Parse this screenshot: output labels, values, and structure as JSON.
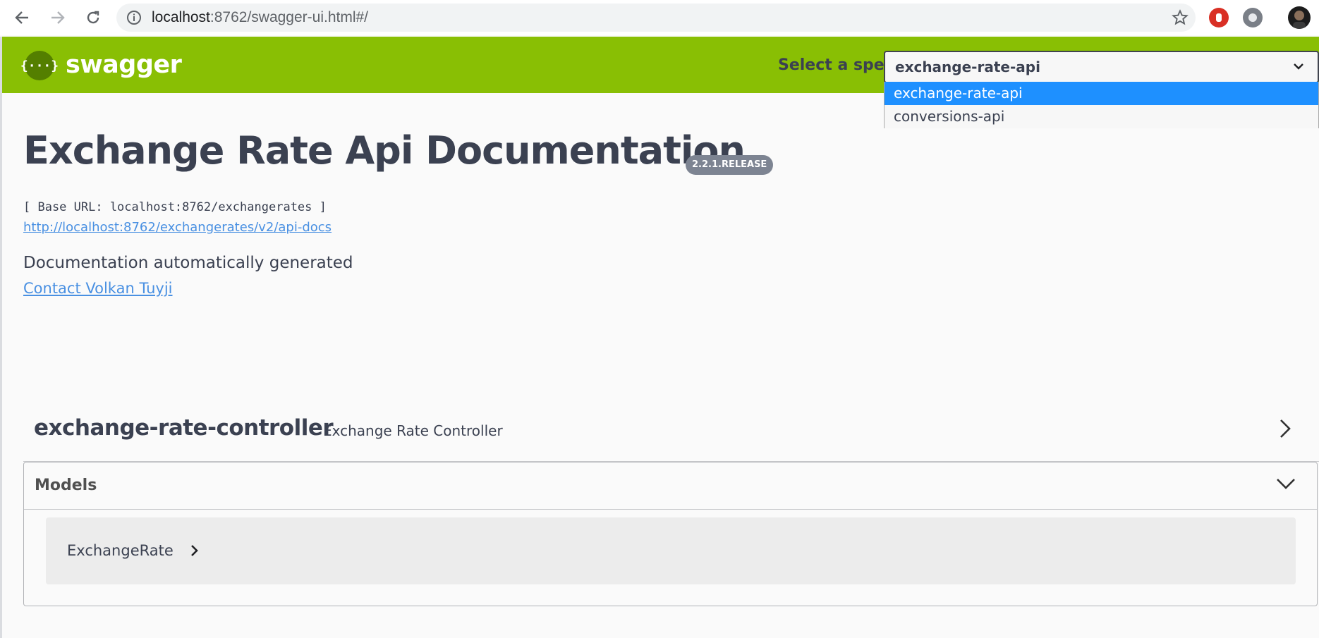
{
  "browser": {
    "url_host": "localhost",
    "url_rest": ":8762/swagger-ui.html#/"
  },
  "topbar": {
    "logo_glyph": "{···}",
    "logo_text": "swagger",
    "spec_label": "Select a spec",
    "spec_selected": "exchange-rate-api",
    "spec_options": [
      "exchange-rate-api",
      "conversions-api"
    ],
    "brand_color": "#89bf04"
  },
  "info": {
    "title": "Exchange Rate Api Documentation",
    "version": "2.2.1.RELEASE",
    "base_url": "[ Base URL: localhost:8762/exchangerates ]",
    "docs_link": "http://localhost:8762/exchangerates/v2/api-docs",
    "description": "Documentation automatically generated",
    "contact": "Contact Volkan Tuyji"
  },
  "tag": {
    "name": "exchange-rate-controller",
    "description": "Exchange Rate Controller"
  },
  "models": {
    "title": "Models",
    "items": [
      "ExchangeRate"
    ]
  }
}
